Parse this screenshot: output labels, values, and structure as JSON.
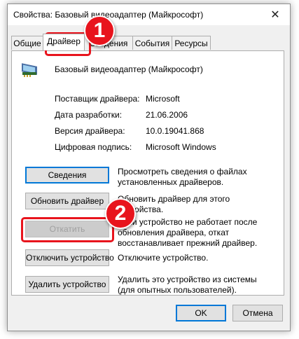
{
  "window": {
    "title": "Свойства: Базовый видеоадаптер (Майкрософт)",
    "close_glyph": "✕"
  },
  "tabs": [
    {
      "label": "Общие"
    },
    {
      "label": "Драйвер",
      "active": true
    },
    {
      "label": "Сведения"
    },
    {
      "label": "События"
    },
    {
      "label": "Ресурсы"
    }
  ],
  "device": {
    "icon": "display-adapter-icon",
    "name": "Базовый видеоадаптер (Майкрософт)"
  },
  "properties": [
    {
      "label": "Поставщик драйвера:",
      "value": "Microsoft"
    },
    {
      "label": "Дата разработки:",
      "value": "21.06.2006"
    },
    {
      "label": "Версия драйвера:",
      "value": "10.0.19041.868"
    },
    {
      "label": "Цифровая подпись:",
      "value": "Microsoft Windows"
    }
  ],
  "actions": [
    {
      "button": "Сведения",
      "description": "Просмотреть сведения о файлах установленных драйверов."
    },
    {
      "button": "Обновить драйвер",
      "description": "Обновить драйвер для этого устройства."
    },
    {
      "button": "Откатить",
      "description": "Если устройство не работает после обновления драйвера, откат восстанавливает прежний драйвер.",
      "disabled": true
    },
    {
      "button": "Отключить устройство",
      "description": "Отключите устройство."
    },
    {
      "button": "Удалить устройство",
      "description": "Удалить это устройство из системы (для опытных пользователей)."
    }
  ],
  "footer": {
    "ok_label": "OK",
    "cancel_label": "Отмена"
  },
  "annotations": {
    "step1": "1",
    "step2": "2",
    "color": "#e8141d"
  }
}
